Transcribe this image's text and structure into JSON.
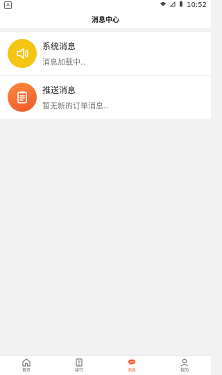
{
  "status": {
    "left_badge": "A",
    "time": "10:52",
    "icons": [
      "wifi-icon",
      "signal-icon",
      "battery-icon"
    ]
  },
  "header": {
    "title": "消息中心"
  },
  "messages": [
    {
      "title": "系统消息",
      "subtitle": "消息加载中..",
      "icon": "speaker-icon"
    },
    {
      "title": "推送消息",
      "subtitle": "暂无新的订单消息..",
      "icon": "clipboard-icon"
    }
  ],
  "bottom_nav": {
    "items": [
      {
        "label": "首页",
        "icon": "home-icon"
      },
      {
        "label": "接行",
        "icon": "list-icon"
      },
      {
        "label": "消息",
        "icon": "message-icon",
        "active": true
      },
      {
        "label": "我的",
        "icon": "user-icon"
      }
    ]
  },
  "colors": {
    "system_icon": "#f5c514",
    "push_icon": "#f0592b",
    "active_nav": "#f35a2f"
  }
}
